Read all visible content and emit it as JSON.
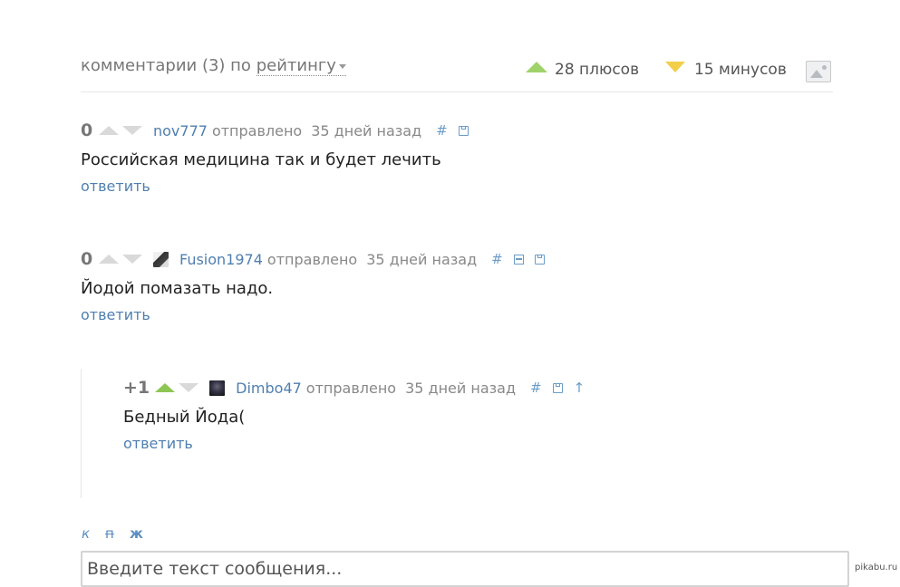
{
  "header": {
    "title_prefix": "комментарии (3) по",
    "sort_label": "рейтингу",
    "pluses_label": "28 плюсов",
    "minuses_label": "15 минусов"
  },
  "comments": [
    {
      "rating": "0",
      "user": "nov777",
      "sent_label": "отправлено",
      "date": "35 дней назад",
      "hash": "#",
      "text": "Российская медицина так и будет лечить",
      "reply": "ответить"
    },
    {
      "rating": "0",
      "user": "Fusion1974",
      "sent_label": "отправлено",
      "date": "35 дней назад",
      "hash": "#",
      "text": "Йодой помазать надо.",
      "reply": "ответить"
    },
    {
      "rating": "+1",
      "user": "Dimbo47",
      "sent_label": "отправлено",
      "date": "35 дней назад",
      "hash": "#",
      "up_arrow": "↑",
      "text": "Бедный Йода(",
      "reply": "ответить"
    }
  ],
  "editor": {
    "italic": "к",
    "strike": "п",
    "bold": "ж",
    "placeholder": "Введите текст сообщения..."
  },
  "watermark": "pikabu.ru",
  "colors": {
    "link": "#4f7fb0",
    "plus": "#8ec654",
    "minus": "#f2cf4a"
  }
}
